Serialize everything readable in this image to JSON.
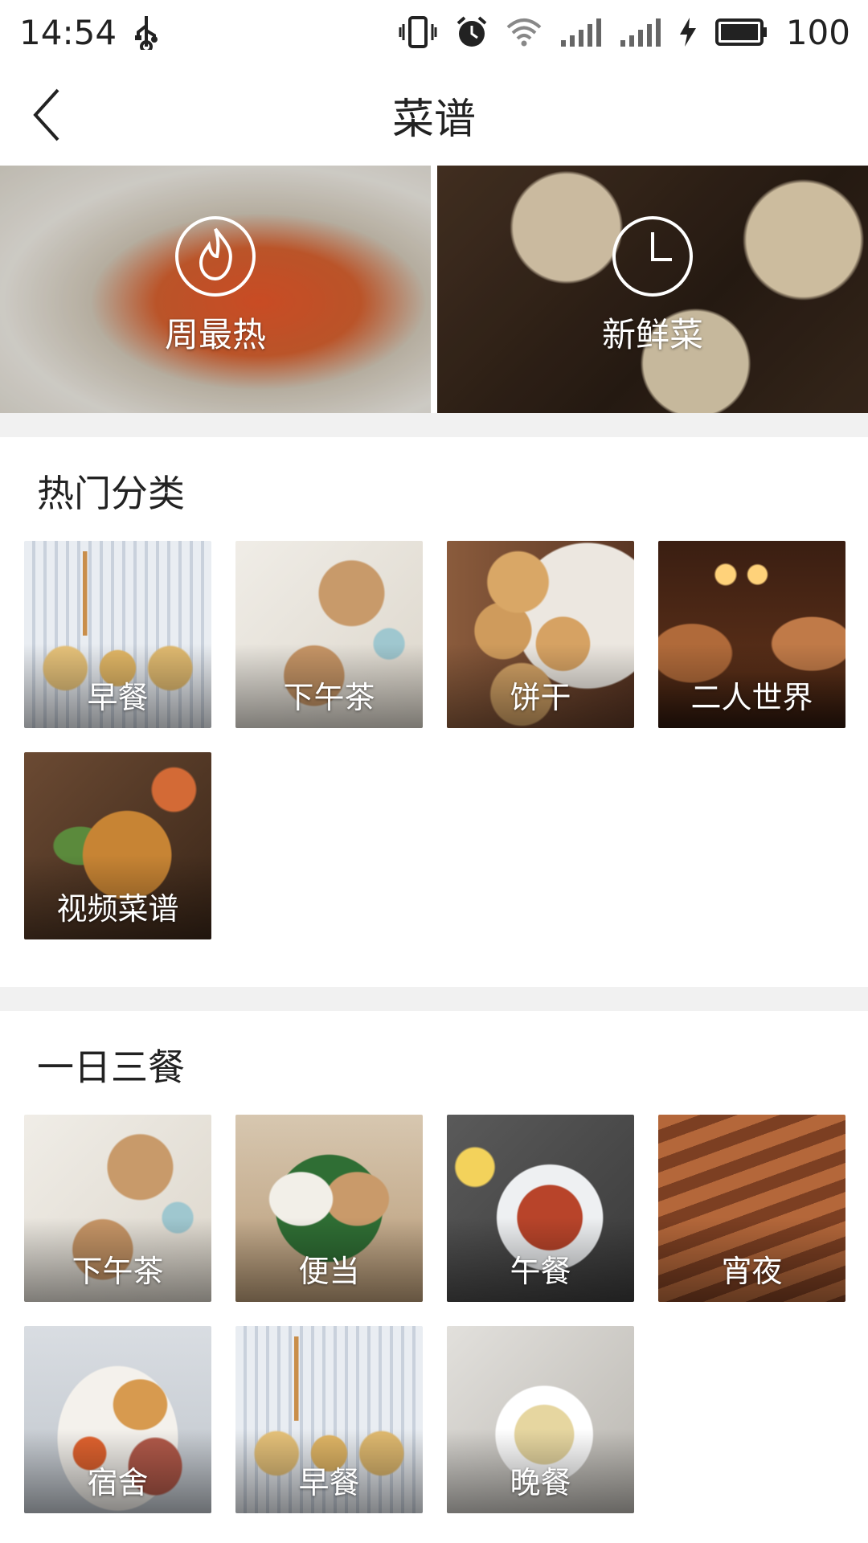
{
  "status_bar": {
    "time": "14:54",
    "battery": "100",
    "icons": [
      "usb-icon",
      "vibrate-icon",
      "alarm-icon",
      "wifi-icon",
      "signal-icon",
      "signal-icon",
      "charging-icon",
      "battery-icon"
    ]
  },
  "header": {
    "title": "菜谱",
    "back_icon": "chevron-left-icon"
  },
  "banner": [
    {
      "label": "周最热",
      "icon": "flame-icon"
    },
    {
      "label": "新鲜菜",
      "icon": "clock-icon"
    }
  ],
  "hot_categories": {
    "title": "热门分类",
    "items": [
      {
        "label": "早餐"
      },
      {
        "label": "下午茶"
      },
      {
        "label": "饼干"
      },
      {
        "label": "二人世界"
      },
      {
        "label": "视频菜谱"
      }
    ]
  },
  "three_meals": {
    "title": "一日三餐",
    "items": [
      {
        "label": "下午茶"
      },
      {
        "label": "便当"
      },
      {
        "label": "午餐"
      },
      {
        "label": "宵夜"
      },
      {
        "label": "宿舍"
      },
      {
        "label": "早餐"
      },
      {
        "label": "晚餐"
      }
    ]
  },
  "colors": {
    "background": "#ffffff",
    "divider_band": "#f1f1f1",
    "text": "#222222"
  }
}
